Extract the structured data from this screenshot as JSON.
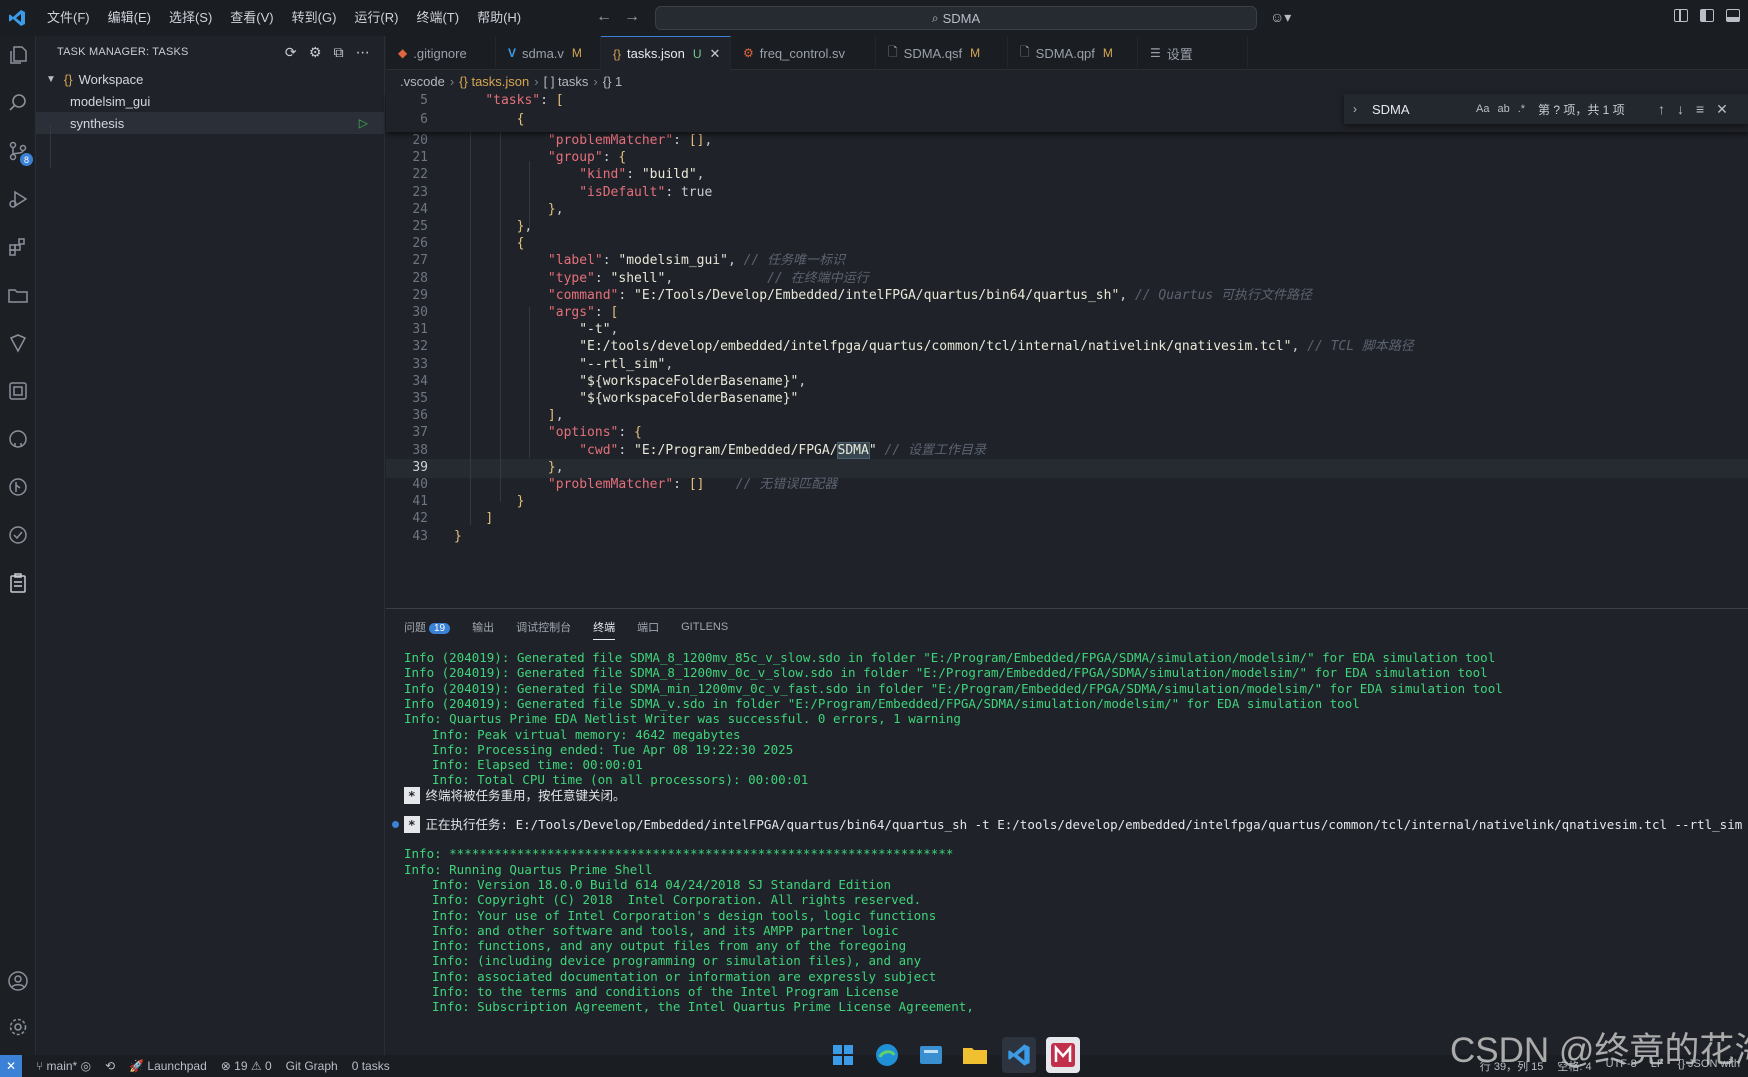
{
  "menu": [
    "文件(F)",
    "编辑(E)",
    "选择(S)",
    "查看(V)",
    "转到(G)",
    "运行(R)",
    "终端(T)",
    "帮助(H)"
  ],
  "command_center": "SDMA",
  "sidebar": {
    "title": "TASK MANAGER: TASKS",
    "workspace": "Workspace",
    "items": [
      "modelsim_gui",
      "synthesis"
    ]
  },
  "activity_badge": "8",
  "tabs": [
    {
      "label": ".gitignore",
      "icon": "git-icon",
      "state": ""
    },
    {
      "label": "sdma.v",
      "icon": "verilog-icon",
      "state": "M"
    },
    {
      "label": "tasks.json",
      "icon": "json-icon",
      "state": "U"
    },
    {
      "label": "freq_control.sv",
      "icon": "sv-icon",
      "state": ""
    },
    {
      "label": "SDMA.qsf",
      "icon": "file-icon",
      "state": "M"
    },
    {
      "label": "SDMA.qpf",
      "icon": "file-icon",
      "state": "M"
    },
    {
      "label": "设置",
      "icon": "settings-icon",
      "state": ""
    }
  ],
  "breadcrumb": [
    ".vscode",
    "{} tasks.json",
    "[ ] tasks",
    "{} 1"
  ],
  "find": {
    "query": "SDMA",
    "result": "第 ? 项，共 1 项",
    "opt_case": "Aa",
    "opt_word": "ab",
    "opt_regex": ".*"
  },
  "editor": {
    "sticky": [
      {
        "n": "5",
        "text": "    \"tasks\": ["
      },
      {
        "n": "6",
        "text": "        {"
      }
    ],
    "lines": [
      {
        "n": "20",
        "text": "            \"problemMatcher\": [],"
      },
      {
        "n": "21",
        "text": "            \"group\": {"
      },
      {
        "n": "22",
        "text": "                \"kind\": \"build\","
      },
      {
        "n": "23",
        "text": "                \"isDefault\": true"
      },
      {
        "n": "24",
        "text": "            },"
      },
      {
        "n": "25",
        "text": "        },"
      },
      {
        "n": "26",
        "text": "        {"
      },
      {
        "n": "27",
        "text": "            \"label\": \"modelsim_gui\", // 任务唯一标识"
      },
      {
        "n": "28",
        "text": "            \"type\": \"shell\",            // 在终端中运行"
      },
      {
        "n": "29",
        "text": "            \"command\": \"E:/Tools/Develop/Embedded/intelFPGA/quartus/bin64/quartus_sh\", // Quartus 可执行文件路径"
      },
      {
        "n": "30",
        "text": "            \"args\": ["
      },
      {
        "n": "31",
        "text": "                \"-t\","
      },
      {
        "n": "32",
        "text": "                \"E:/tools/develop/embedded/intelfpga/quartus/common/tcl/internal/nativelink/qnativesim.tcl\", // TCL 脚本路径"
      },
      {
        "n": "33",
        "text": "                \"--rtl_sim\","
      },
      {
        "n": "34",
        "text": "                \"${workspaceFolderBasename}\","
      },
      {
        "n": "35",
        "text": "                \"${workspaceFolderBasename}\""
      },
      {
        "n": "36",
        "text": "            ],"
      },
      {
        "n": "37",
        "text": "            \"options\": {"
      },
      {
        "n": "38",
        "text": "                \"cwd\": \"E:/Program/Embedded/FPGA/SDMA\" // 设置工作目录"
      },
      {
        "n": "39",
        "text": "            },"
      },
      {
        "n": "40",
        "text": "            \"problemMatcher\": []    // 无错误匹配器"
      },
      {
        "n": "41",
        "text": "        }"
      },
      {
        "n": "42",
        "text": "    ]"
      },
      {
        "n": "43",
        "text": "}"
      }
    ]
  },
  "panel": {
    "tabs": [
      "问题",
      "输出",
      "调试控制台",
      "终端",
      "端口",
      "GITLENS"
    ],
    "problems_count": "19",
    "active_tab": "终端",
    "terminal": [
      {
        "text": "Info (204019): Generated file SDMA_8_1200mv_85c_v_slow.sdo in folder \"E:/Program/Embedded/FPGA/SDMA/simulation/modelsim/\" for EDA simulation tool",
        "kind": "g"
      },
      {
        "text": "Info (204019): Generated file SDMA_8_1200mv_0c_v_slow.sdo in folder \"E:/Program/Embedded/FPGA/SDMA/simulation/modelsim/\" for EDA simulation tool",
        "kind": "g"
      },
      {
        "text": "Info (204019): Generated file SDMA_min_1200mv_0c_v_fast.sdo in folder \"E:/Program/Embedded/FPGA/SDMA/simulation/modelsim/\" for EDA simulation tool",
        "kind": "g"
      },
      {
        "text": "Info (204019): Generated file SDMA_v.sdo in folder \"E:/Program/Embedded/FPGA/SDMA/simulation/modelsim/\" for EDA simulation tool",
        "kind": "g"
      },
      {
        "text": "Info: Quartus Prime EDA Netlist Writer was successful. 0 errors, 1 warning",
        "kind": "g"
      },
      {
        "text": "Info: Peak virtual memory: 4642 megabytes",
        "kind": "gi"
      },
      {
        "text": "Info: Processing ended: Tue Apr 08 19:22:30 2025",
        "kind": "gi"
      },
      {
        "text": "Info: Elapsed time: 00:00:01",
        "kind": "gi"
      },
      {
        "text": "Info: Total CPU time (on all processors): 00:00:01",
        "kind": "gi"
      },
      {
        "text": "终端将被任务重用，按任意键关闭。",
        "kind": "star"
      },
      {
        "text": "",
        "kind": "blank"
      },
      {
        "text": "正在执行任务: E:/Tools/Develop/Embedded/intelFPGA/quartus/bin64/quartus_sh -t E:/tools/develop/embedded/intelfpga/quartus/common/tcl/internal/nativelink/qnativesim.tcl --rtl_sim SDMA SDMA",
        "kind": "star-dot"
      },
      {
        "text": "",
        "kind": "blank"
      },
      {
        "text": "Info: *******************************************************************",
        "kind": "g"
      },
      {
        "text": "Info: Running Quartus Prime Shell",
        "kind": "g"
      },
      {
        "text": "Info: Version 18.0.0 Build 614 04/24/2018 SJ Standard Edition",
        "kind": "gi"
      },
      {
        "text": "Info: Copyright (C) 2018  Intel Corporation. All rights reserved.",
        "kind": "gi"
      },
      {
        "text": "Info: Your use of Intel Corporation's design tools, logic functions",
        "kind": "gi"
      },
      {
        "text": "Info: and other software and tools, and its AMPP partner logic",
        "kind": "gi"
      },
      {
        "text": "Info: functions, and any output files from any of the foregoing",
        "kind": "gi"
      },
      {
        "text": "Info: (including device programming or simulation files), and any",
        "kind": "gi"
      },
      {
        "text": "Info: associated documentation or information are expressly subject",
        "kind": "gi"
      },
      {
        "text": "Info: to the terms and conditions of the Intel Program License",
        "kind": "gi"
      },
      {
        "text": "Info: Subscription Agreement, the Intel Quartus Prime License Agreement,",
        "kind": "gi"
      }
    ]
  },
  "status": {
    "branch": "main*",
    "launchpad": "Launchpad",
    "errors": "19",
    "warnings": "0",
    "gitgraph": "Git Graph",
    "tasks": "0 tasks",
    "position": "行 39，列 15",
    "spaces": "空格: 4",
    "encoding": "UTF-8",
    "eol": "LF",
    "language": "{} JSON with"
  },
  "watermark": "CSDN @终竟的花海",
  "colors": {
    "accent": "#3b82d6",
    "terminal_green": "#3fd47a",
    "modified": "#d7a652"
  }
}
